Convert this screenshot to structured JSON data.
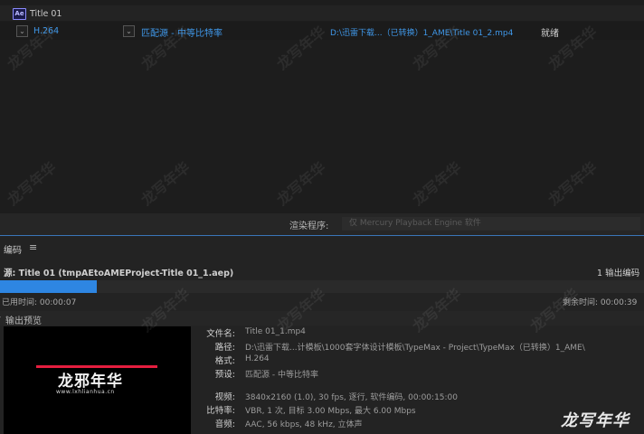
{
  "queue": {
    "item_title": "Title 01",
    "ae_badge": "Ae",
    "row": {
      "format": "H.264",
      "preset": "匹配源 - 中等比特率",
      "output": "D:\\迅雷下载...（已转换）1_AME\\Title 01_2.mp4",
      "status": "就绪"
    },
    "renderer_label": "渲染程序:",
    "renderer_value": "仅 Mercury Playback Engine 软件"
  },
  "encoding": {
    "title": "编码",
    "menu_icon": "≡",
    "job_name": "源: Title 01 (tmpAEtoAMEProject-Title 01_1.aep)",
    "output_count": "1 输出编码",
    "progress": 0.15,
    "time_used": "已用时间: 00:00:07",
    "time_left": "剩余时间: 00:00:39",
    "preview_label": "输出预览",
    "preview": {
      "logo": "龙邪年华",
      "url": "www.lxhlianhua.cn"
    },
    "details": {
      "file_label": "文件名:",
      "file_value": "Title 01_1.mp4",
      "path_label": "路径:",
      "path_value": "D:\\迅雷下载...计模板\\1000套字体设计模板\\TypeMax - Project\\TypeMax（已转换）1_AME\\",
      "format_label": "格式:",
      "format_value": "H.264",
      "preset_label": "预设:",
      "preset_value": "匹配源 - 中等比特率",
      "video_label": "视频:",
      "video_value": "3840x2160 (1.0), 30 fps, 逐行, 软件编码, 00:00:15:00",
      "bitrate_label": "比特率:",
      "bitrate_value": "VBR, 1 次, 目标 3.00 Mbps, 最大 6.00 Mbps",
      "audio_label": "音频:",
      "audio_value": "AAC, 56 kbps, 48 kHz, 立体声"
    }
  },
  "watermark": "龙写年华",
  "colors": {
    "accent": "#2e86e2",
    "link": "#3f97e8",
    "preview_bar": "#e51e3f"
  }
}
